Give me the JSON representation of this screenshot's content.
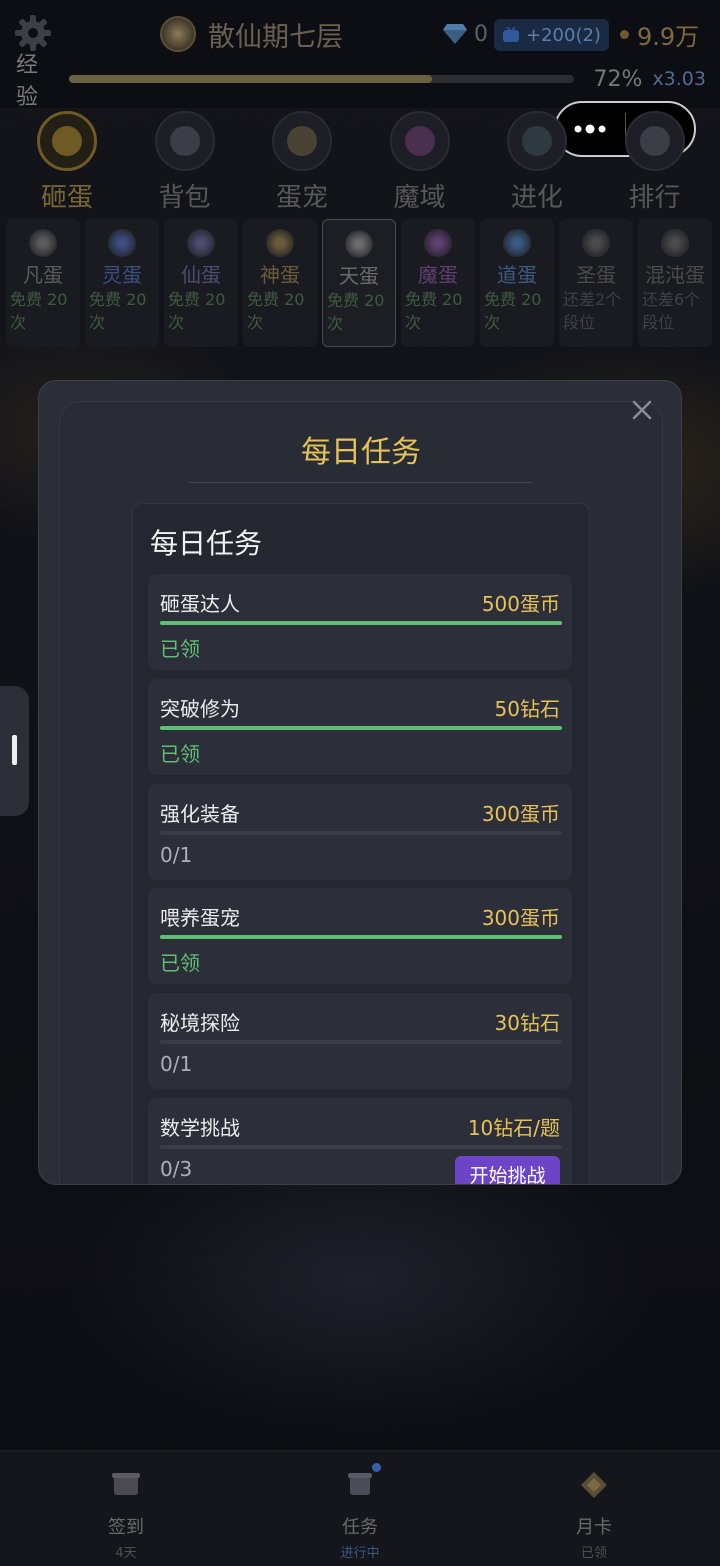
{
  "header": {
    "realm_title": "散仙期七层",
    "diamonds": "0",
    "tv_bonus": "+200(2)",
    "coins": "9.9万",
    "exp": {
      "label": "经验",
      "percent_text": "72%",
      "progress": 0.72,
      "multiplier": "x3.03"
    }
  },
  "main_tabs": [
    {
      "label": "砸蛋",
      "active": true
    },
    {
      "label": "背包"
    },
    {
      "label": "蛋宠"
    },
    {
      "label": "魔域"
    },
    {
      "label": "进化"
    },
    {
      "label": "排行"
    }
  ],
  "egg_types": [
    {
      "name": "凡蛋",
      "note": "免费 20次",
      "color": "#5a5a5a"
    },
    {
      "name": "灵蛋",
      "note": "免费 20次",
      "color": "#3e4d80"
    },
    {
      "name": "仙蛋",
      "note": "免费 20次",
      "color": "#4f4b6e"
    },
    {
      "name": "神蛋",
      "note": "免费 20次",
      "color": "#6b5a3a"
    },
    {
      "name": "天蛋",
      "note": "免费 20次",
      "color": "#6a6a6a",
      "active": true
    },
    {
      "name": "魔蛋",
      "note": "免费 20次",
      "color": "#5e3f6e"
    },
    {
      "name": "道蛋",
      "note": "免费 20次",
      "color": "#3c5a80"
    },
    {
      "name": "圣蛋",
      "note": "还差2个段位",
      "color": "#4a4a4a"
    },
    {
      "name": "混沌蛋",
      "note": "还差6个段位",
      "color": "#4a4a4a"
    }
  ],
  "modal": {
    "title": "每日任务",
    "panel_title": "每日任务",
    "tasks": [
      {
        "name": "砸蛋达人",
        "reward": "500蛋币",
        "status": "已领",
        "progress": 1
      },
      {
        "name": "突破修为",
        "reward": "50钻石",
        "status": "已领",
        "progress": 1
      },
      {
        "name": "强化装备",
        "reward": "300蛋币",
        "status": "0/1",
        "progress": 0
      },
      {
        "name": "喂养蛋宠",
        "reward": "300蛋币",
        "status": "已领",
        "progress": 1
      },
      {
        "name": "秘境探险",
        "reward": "30钻石",
        "status": "0/1",
        "progress": 0
      },
      {
        "name": "数学挑战",
        "reward": "10钻石/题",
        "status": "0/3",
        "progress": 0,
        "button": "开始挑战"
      }
    ]
  },
  "bottom_nav": [
    {
      "label": "签到",
      "sub": "4天"
    },
    {
      "label": "任务",
      "sub": "进行中",
      "active": true
    },
    {
      "label": "月卡",
      "sub": "已领"
    }
  ],
  "colors": {
    "gold": "#e6c257",
    "green": "#5fbf75",
    "purple": "#6e44c7"
  }
}
